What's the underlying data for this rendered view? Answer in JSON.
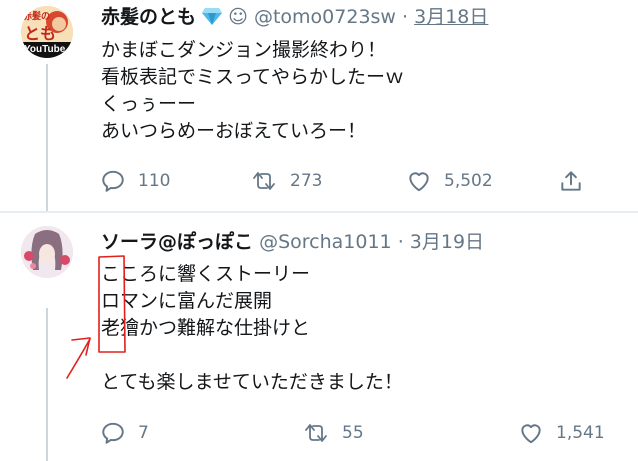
{
  "tweets": [
    {
      "display_name": "赤髪のとも",
      "handle": "@tomo0723sw",
      "separator": "·",
      "date": "3月18日",
      "avatar": {
        "text_top": "赤髪の",
        "text_mid": "とも",
        "brand": "YouTube"
      },
      "lines": [
        "かまぼこダンジョン撮影終わり！",
        "看板表記でミスってやらかしたーｗ",
        "くっぅーー",
        "あいつらめーおぼえていろー！"
      ],
      "replies": "110",
      "retweets": "273",
      "likes": "5,502"
    },
    {
      "display_name": "ソーラ@ぽっぽこ",
      "handle": "@Sorcha1011",
      "separator": "·",
      "date": "3月19日",
      "lines": [
        "こころに響くストーリー",
        "ロマンに富んだ展開",
        "老獪かつ難解な仕掛けと",
        "",
        "とても楽しませていただきました！"
      ],
      "replies": "7",
      "retweets": "55",
      "likes": "1,541"
    }
  ],
  "colors": {
    "text": "#14171a",
    "secondary": "#657786",
    "divider": "#e6ecf0",
    "thread_line": "#ccd6dd",
    "annotation_red": "#e0201b",
    "gem": "#4fb8e8"
  }
}
